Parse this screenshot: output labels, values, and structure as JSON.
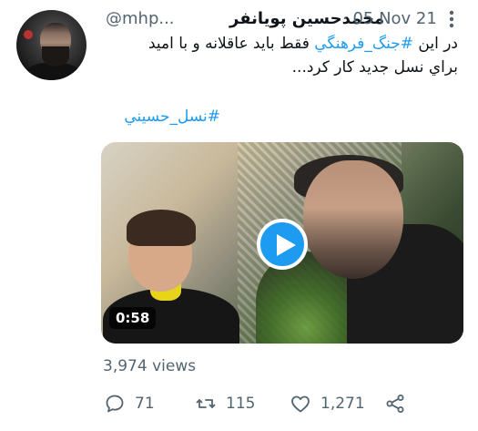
{
  "tweet": {
    "author_name": "محمدحسین پویانفر",
    "handle": "@mhp...",
    "date": "· 05 Nov 21",
    "text_line1_prefix": "در این ",
    "text_line1_hashtag": "#جنگ_فرهنگي",
    "text_line1_suffix": " فقط باید عاقلانه و با امید",
    "text_line2": "براي نسل جدید کار کرد...",
    "tag": "#نسل_حسيني",
    "video_duration": "0:58",
    "views": "3,974 views",
    "replies": "71",
    "retweets": "115",
    "likes": "1,271"
  },
  "icons": {
    "more": "more-vertical-icon",
    "reply": "reply-icon",
    "retweet": "retweet-icon",
    "like": "heart-icon",
    "share": "share-icon",
    "play": "play-icon"
  },
  "colors": {
    "accent": "#1d9bf0",
    "muted": "#536471",
    "text": "#0f1419"
  }
}
